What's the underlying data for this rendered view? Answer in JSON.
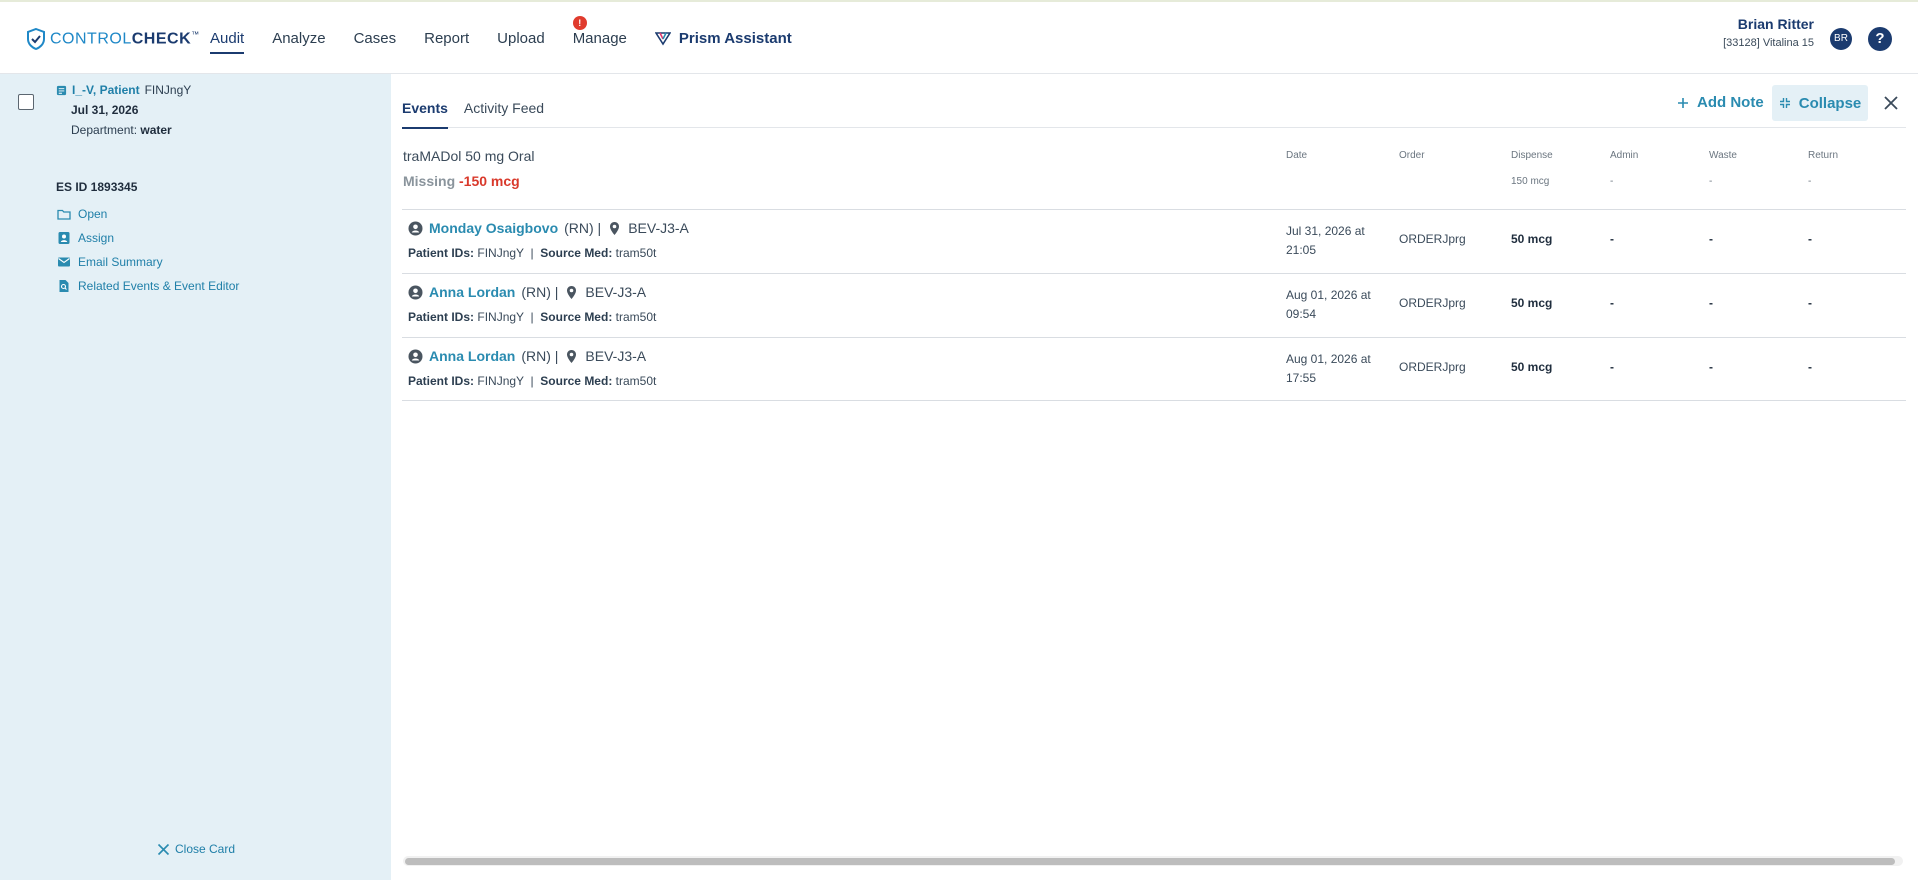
{
  "header": {
    "logo": {
      "part1": "CONTROL",
      "part2": "CHECK",
      "tm": "™"
    },
    "nav": [
      "Audit",
      "Analyze",
      "Cases",
      "Report",
      "Upload",
      "Manage"
    ],
    "active_nav": "Audit",
    "manage_badge": "!",
    "prism_label": "Prism Assistant",
    "user_name": "Brian Ritter",
    "user_sub": "[33128] Vitalina 15",
    "avatar_initials": "BR",
    "help_label": "?"
  },
  "left_panel": {
    "patient_name": "I_-V, Patient",
    "patient_fin": "FINJngY",
    "date": "Jul 31, 2026",
    "department_label": "Department:",
    "department_value": "water",
    "es_id": "ES ID 1893345",
    "actions": [
      "Open",
      "Assign",
      "Email Summary",
      "Related Events & Event Editor"
    ],
    "close_card": "Close Card"
  },
  "right_panel": {
    "tabs": [
      "Events",
      "Activity Feed"
    ],
    "active_tab": "Events",
    "add_note": "Add Note",
    "collapse": "Collapse",
    "drug": "traMADol 50 mg Oral",
    "missing_label": "Missing",
    "missing_value": "-150 mcg",
    "columns": [
      "Date",
      "Order",
      "Dispense",
      "Admin",
      "Waste",
      "Return"
    ],
    "summary": {
      "dispense": "150 mcg",
      "admin": "-",
      "waste": "-",
      "return": "-"
    },
    "rows": [
      {
        "user": "Monday Osaigbovo",
        "role": "(RN) |",
        "location": "BEV-J3-A",
        "patient_ids_label": "Patient IDs:",
        "patient_ids": "FINJngY",
        "sep": "|",
        "source_med_label": "Source Med:",
        "source_med": "tram50t",
        "date": "Jul 31, 2026 at 21:05",
        "order": "ORDERJprg",
        "dispense": "50 mcg",
        "admin": "-",
        "waste": "-",
        "return": "-"
      },
      {
        "user": "Anna Lordan",
        "role": "(RN) |",
        "location": "BEV-J3-A",
        "patient_ids_label": "Patient IDs:",
        "patient_ids": "FINJngY",
        "sep": "|",
        "source_med_label": "Source Med:",
        "source_med": "tram50t",
        "date": "Aug 01, 2026 at 09:54",
        "order": "ORDERJprg",
        "dispense": "50 mcg",
        "admin": "-",
        "waste": "-",
        "return": "-"
      },
      {
        "user": "Anna Lordan",
        "role": "(RN) |",
        "location": "BEV-J3-A",
        "patient_ids_label": "Patient IDs:",
        "patient_ids": "FINJngY",
        "sep": "|",
        "source_med_label": "Source Med:",
        "source_med": "tram50t",
        "date": "Aug 01, 2026 at 17:55",
        "order": "ORDERJprg",
        "dispense": "50 mcg",
        "admin": "-",
        "waste": "-",
        "return": "-"
      }
    ]
  },
  "colors": {
    "brand_navy": "#1b3b6f",
    "link_teal": "#2a8bb0",
    "panel_bg": "#e4f0f6",
    "danger": "#d9392b"
  }
}
